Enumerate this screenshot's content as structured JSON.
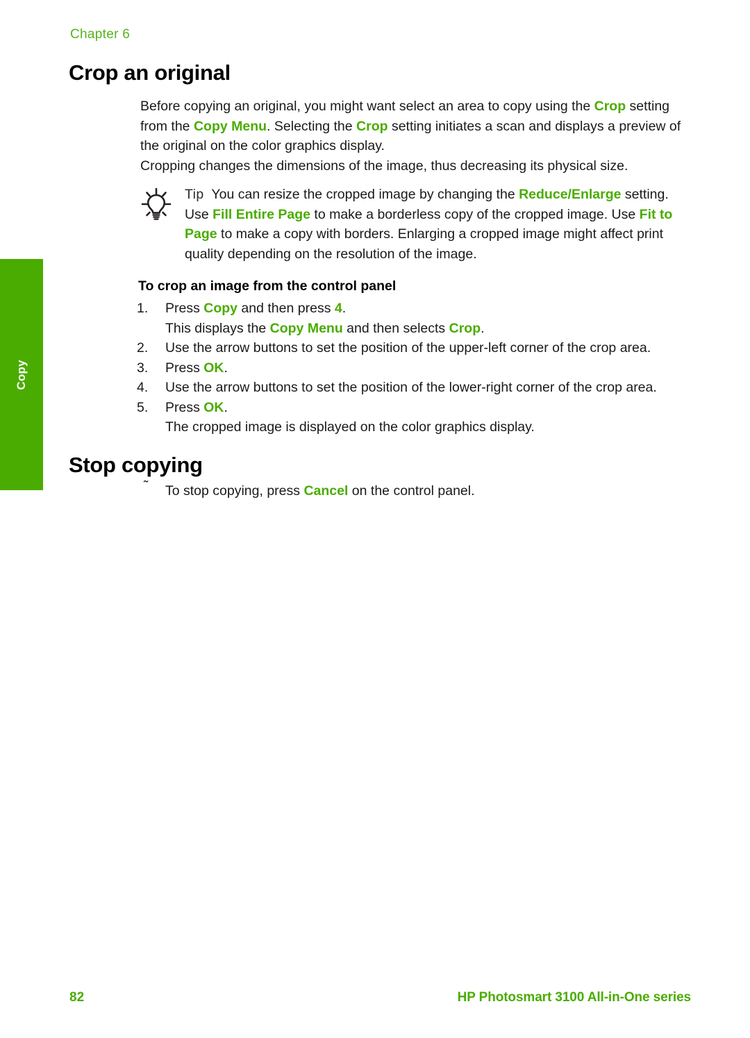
{
  "chapter": {
    "label": "Chapter 6"
  },
  "side_tab": {
    "label": "Copy",
    "color": "#4aac00"
  },
  "accent_color": "#4aac00",
  "sections": [
    {
      "heading": "Crop an original"
    },
    {
      "heading": "Stop copying"
    }
  ],
  "intro": {
    "p1_a": "Before copying an original, you might want select an area to copy using the ",
    "p1_crop1": "Crop",
    "p1_b": " setting from the ",
    "p1_copymenu": "Copy Menu",
    "p1_c": ". Selecting the ",
    "p1_crop2": "Crop",
    "p1_d": " setting initiates a scan and displays a preview of the original on the color graphics display.",
    "p2": "Cropping changes the dimensions of the image, thus decreasing its physical size."
  },
  "tip": {
    "icon": "lightbulb-icon",
    "label": "Tip",
    "a": "You can resize the cropped image by changing the ",
    "reduce_enlarge": "Reduce/Enlarge",
    "b": " setting. Use ",
    "fill_entire_page": "Fill Entire Page",
    "c": " to make a borderless copy of the cropped image. Use ",
    "fit_to_page": "Fit to Page",
    "d": " to make a copy with borders. Enlarging a cropped image might affect print quality depending on the resolution of the image."
  },
  "procedure": {
    "title": "To crop an image from the control panel",
    "steps": [
      {
        "num": "1.",
        "a": "Press ",
        "g1": "Copy",
        "b": " and then press ",
        "g2": "4",
        "c": ".",
        "sub_a": "This displays the ",
        "sub_g1": "Copy Menu",
        "sub_b": " and then selects ",
        "sub_g2": "Crop",
        "sub_c": "."
      },
      {
        "num": "2.",
        "a": "Use the arrow buttons to set the position of the upper-left corner of the crop area.",
        "g1": "",
        "b": "",
        "g2": "",
        "c": ""
      },
      {
        "num": "3.",
        "a": "Press ",
        "g1": "OK",
        "b": "",
        "g2": "",
        "c": "."
      },
      {
        "num": "4.",
        "a": "Use the arrow buttons to set the position of the lower-right corner of the crop area.",
        "g1": "",
        "b": "",
        "g2": "",
        "c": ""
      },
      {
        "num": "5.",
        "a": "Press ",
        "g1": "OK",
        "b": "",
        "g2": "",
        "c": ".",
        "sub_a": "The cropped image is displayed on the color graphics display.",
        "sub_g1": "",
        "sub_b": "",
        "sub_g2": "",
        "sub_c": ""
      }
    ]
  },
  "stop_copying": {
    "marker": "˜",
    "a": "To stop copying, press ",
    "cancel": "Cancel",
    "b": " on the control panel."
  },
  "footer": {
    "page_number": "82",
    "product": "HP Photosmart 3100 All-in-One series"
  }
}
